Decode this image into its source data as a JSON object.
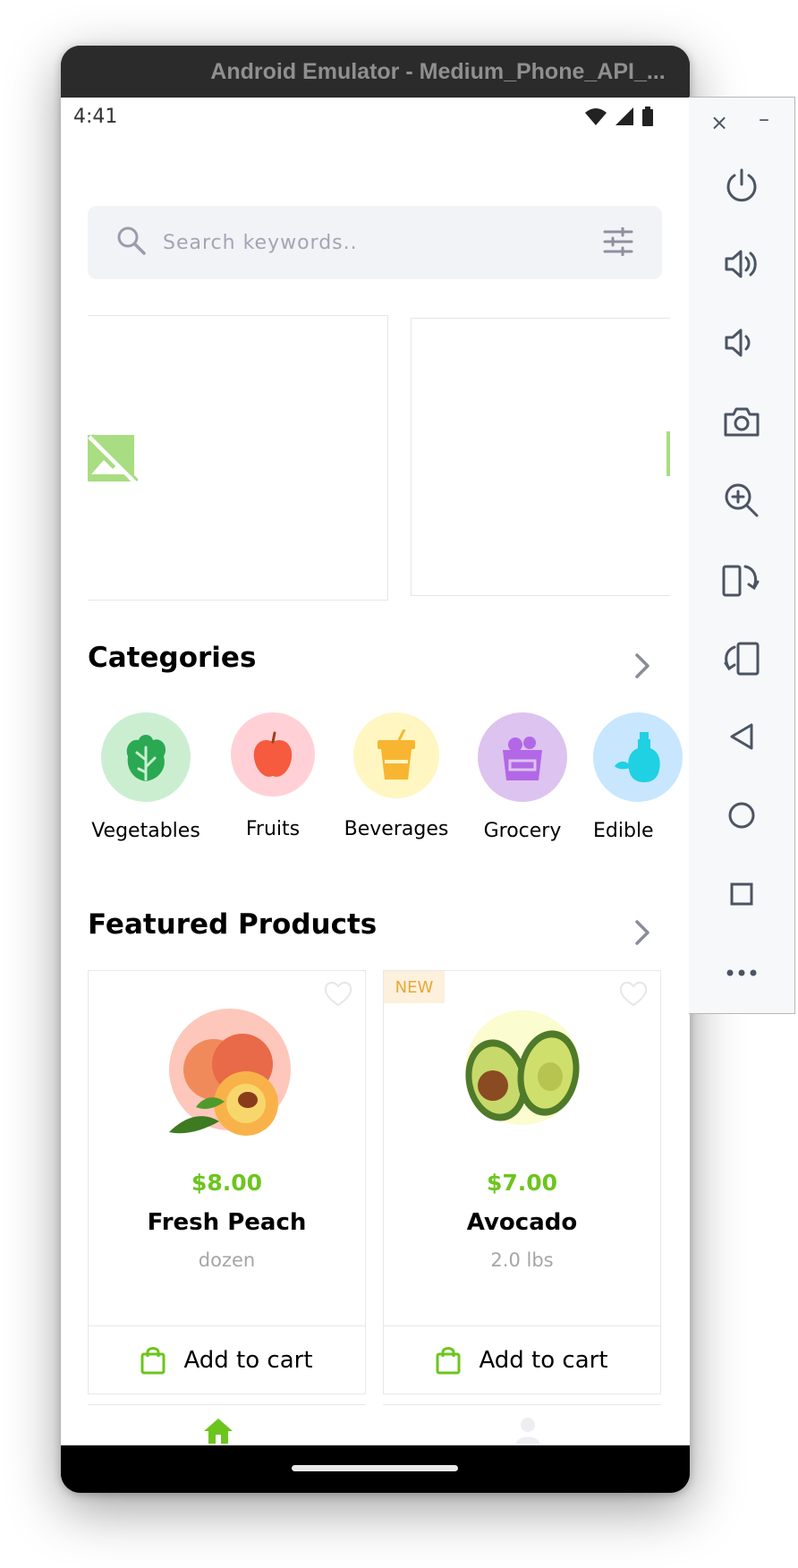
{
  "window": {
    "title": "Android Emulator - Medium_Phone_API_..."
  },
  "status_bar": {
    "time": "4:41"
  },
  "search": {
    "placeholder": "Search keywords.."
  },
  "categories": {
    "title": "Categories",
    "items": [
      {
        "label": "Vegetables",
        "icon": "lettuce-icon",
        "bg": "#cbeed1",
        "fg": "#2aa952"
      },
      {
        "label": "Fruits",
        "icon": "apple-icon",
        "bg": "#ffd1d6",
        "fg": "#f65b3f"
      },
      {
        "label": "Beverages",
        "icon": "juice-icon",
        "bg": "#fff6c2",
        "fg": "#f8b531"
      },
      {
        "label": "Grocery",
        "icon": "grocery-basket-icon",
        "bg": "#ddc3ef",
        "fg": "#b268e6"
      },
      {
        "label": "Edible",
        "icon": "oil-bottle-icon",
        "bg": "#c8e6fd",
        "fg": "#1fd1e3"
      }
    ]
  },
  "featured": {
    "title": "Featured Products",
    "products": [
      {
        "price": "$8.00",
        "name": "Fresh Peach",
        "unit": "dozen",
        "badge": "",
        "image_bg": "#fdc7bb",
        "add_label": "Add to cart"
      },
      {
        "price": "$7.00",
        "name": "Avocado",
        "unit": "2.0 lbs",
        "badge": "NEW",
        "image_bg": "#fbfccf",
        "add_label": "Add to cart"
      }
    ]
  },
  "colors": {
    "accent": "#6cc51d",
    "muted": "#a3a5b3"
  }
}
